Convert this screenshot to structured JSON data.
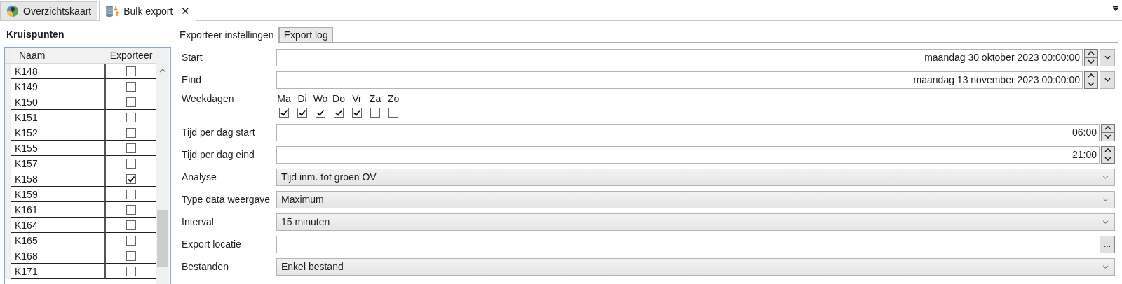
{
  "doc_tabs": [
    {
      "label": "Overzichtskaart",
      "selected": false
    },
    {
      "label": "Bulk export",
      "selected": true,
      "close": "✕"
    }
  ],
  "left_panel": {
    "title": "Kruispunten",
    "columns": [
      "Naam",
      "Exporteer"
    ],
    "rows": [
      {
        "name": "K148",
        "checked": false
      },
      {
        "name": "K149",
        "checked": false
      },
      {
        "name": "K150",
        "checked": false
      },
      {
        "name": "K151",
        "checked": false
      },
      {
        "name": "K152",
        "checked": false
      },
      {
        "name": "K155",
        "checked": false
      },
      {
        "name": "K157",
        "checked": false
      },
      {
        "name": "K158",
        "checked": true
      },
      {
        "name": "K159",
        "checked": false
      },
      {
        "name": "K161",
        "checked": false
      },
      {
        "name": "K164",
        "checked": false
      },
      {
        "name": "K165",
        "checked": false
      },
      {
        "name": "K168",
        "checked": false
      },
      {
        "name": "K171",
        "checked": false
      }
    ]
  },
  "settings_tabs": [
    {
      "label": "Exporteer instellingen",
      "selected": true
    },
    {
      "label": "Export log",
      "selected": false
    }
  ],
  "form": [
    {
      "kind": "datetime",
      "label": "Start",
      "value": "maandag 30 oktober 2023 00:00:00"
    },
    {
      "kind": "datetime",
      "label": "Eind",
      "value": "maandag 13 november 2023 00:00:00"
    },
    {
      "kind": "weekdays",
      "label": "Weekdagen",
      "days": [
        {
          "label": "Ma",
          "checked": true
        },
        {
          "label": "Di",
          "checked": true
        },
        {
          "label": "Wo",
          "checked": true
        },
        {
          "label": "Do",
          "checked": true
        },
        {
          "label": "Vr",
          "checked": true
        },
        {
          "label": "Za",
          "checked": false
        },
        {
          "label": "Zo",
          "checked": false
        }
      ]
    },
    {
      "kind": "time",
      "label": "Tijd per dag start",
      "value": "06:00"
    },
    {
      "kind": "time",
      "label": "Tijd per dag eind",
      "value": "21:00"
    },
    {
      "kind": "combo",
      "label": "Analyse",
      "value": "Tijd inm. tot groen OV"
    },
    {
      "kind": "combo",
      "label": "Type data weergave",
      "value": "Maximum"
    },
    {
      "kind": "combo",
      "label": "Interval",
      "value": "15 minuten"
    },
    {
      "kind": "path",
      "label": "Export locatie",
      "button": "..."
    },
    {
      "kind": "combo",
      "label": "Bestanden",
      "value": "Enkel bestand"
    }
  ]
}
